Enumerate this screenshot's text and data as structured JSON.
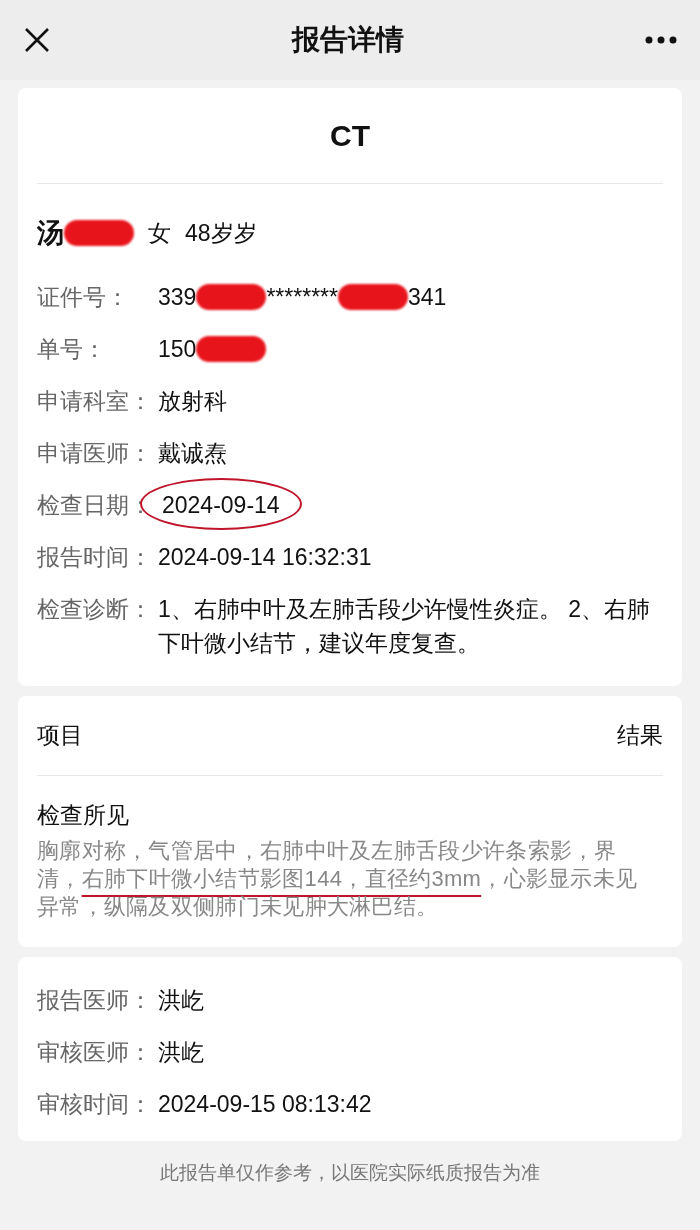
{
  "header": {
    "title": "报告详情"
  },
  "report": {
    "title": "CT",
    "patient": {
      "name": [
        {
          "kind": "text",
          "text": "汤"
        },
        {
          "kind": "redaction"
        }
      ],
      "sex": "女",
      "age": "48岁岁"
    },
    "fields": [
      {
        "label": "证件号：",
        "value": [
          {
            "kind": "text",
            "text": "339"
          },
          {
            "kind": "redaction"
          },
          {
            "kind": "text",
            "text": "********"
          },
          {
            "kind": "redaction"
          },
          {
            "kind": "text",
            "text": "341"
          }
        ]
      },
      {
        "label": "单号：",
        "value": [
          {
            "kind": "text",
            "text": "150"
          },
          {
            "kind": "redaction"
          }
        ]
      },
      {
        "label": "申请科室：",
        "value": [
          {
            "kind": "text",
            "text": "放射科"
          }
        ]
      },
      {
        "label": "申请医师：",
        "value": [
          {
            "kind": "text",
            "text": "戴诚焘"
          }
        ]
      },
      {
        "label": "检查日期：",
        "value": [
          {
            "kind": "circled",
            "text": "2024-09-14"
          }
        ]
      },
      {
        "label": "报告时间：",
        "value": [
          {
            "kind": "text",
            "text": "2024-09-14 16:32:31"
          }
        ]
      },
      {
        "label": "检查诊断：",
        "value": [
          {
            "kind": "text",
            "text": "1、右肺中叶及左肺舌段少许慢性炎症。 2、右肺下叶微小结节，建议年度复查。"
          }
        ]
      }
    ]
  },
  "items": {
    "column_left": "项目",
    "column_right": "结果",
    "section_title": "检查所见",
    "findings": [
      {
        "kind": "text",
        "text": "胸廓对称，气管居中，右肺中叶及左肺舌段少许条索影，界清，"
      },
      {
        "kind": "underlined",
        "text": "右肺下叶微小结节影图144，直径约3mm"
      },
      {
        "kind": "text",
        "text": "，心影显示未见异常，纵隔及双侧肺门未见肿大淋巴结。"
      }
    ]
  },
  "signoff": [
    {
      "label": "报告医师：",
      "value": "洪屹"
    },
    {
      "label": "审核医师：",
      "value": "洪屹"
    },
    {
      "label": "审核时间：",
      "value": "2024-09-15 08:13:42"
    }
  ],
  "footer_note": "此报告单仅作参考，以医院实际纸质报告为准"
}
